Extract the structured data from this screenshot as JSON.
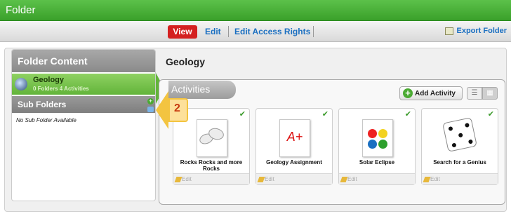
{
  "window": {
    "title": "Folder"
  },
  "toolbar": {
    "view_label": "View",
    "edit_label": "Edit",
    "edit_access_label": "Edit Access Rights",
    "export_label": "Export Folder"
  },
  "sidebar": {
    "heading": "Folder Content",
    "folder": {
      "name": "Geology",
      "summary": "0 Folders 4 Activities"
    },
    "subfolders_heading": "Sub Folders",
    "empty_text": "No Sub Folder Available"
  },
  "main": {
    "title": "Geology",
    "activities_tab": "Activities",
    "add_activity_label": "Add Activity",
    "cards": [
      {
        "label": "Rocks Rocks and more Rocks",
        "edit": "Edit"
      },
      {
        "label": "Geology Assignment",
        "edit": "Edit",
        "graphic_text": "A+"
      },
      {
        "label": "Solar Eclipse",
        "edit": "Edit"
      },
      {
        "label": "Search for a Genius",
        "edit": "Edit"
      }
    ]
  },
  "callout": {
    "number": "2"
  },
  "colors": {
    "brand_green": "#3aa02a",
    "view_tab_red": "#d42020",
    "link_blue": "#1a6fc1"
  }
}
